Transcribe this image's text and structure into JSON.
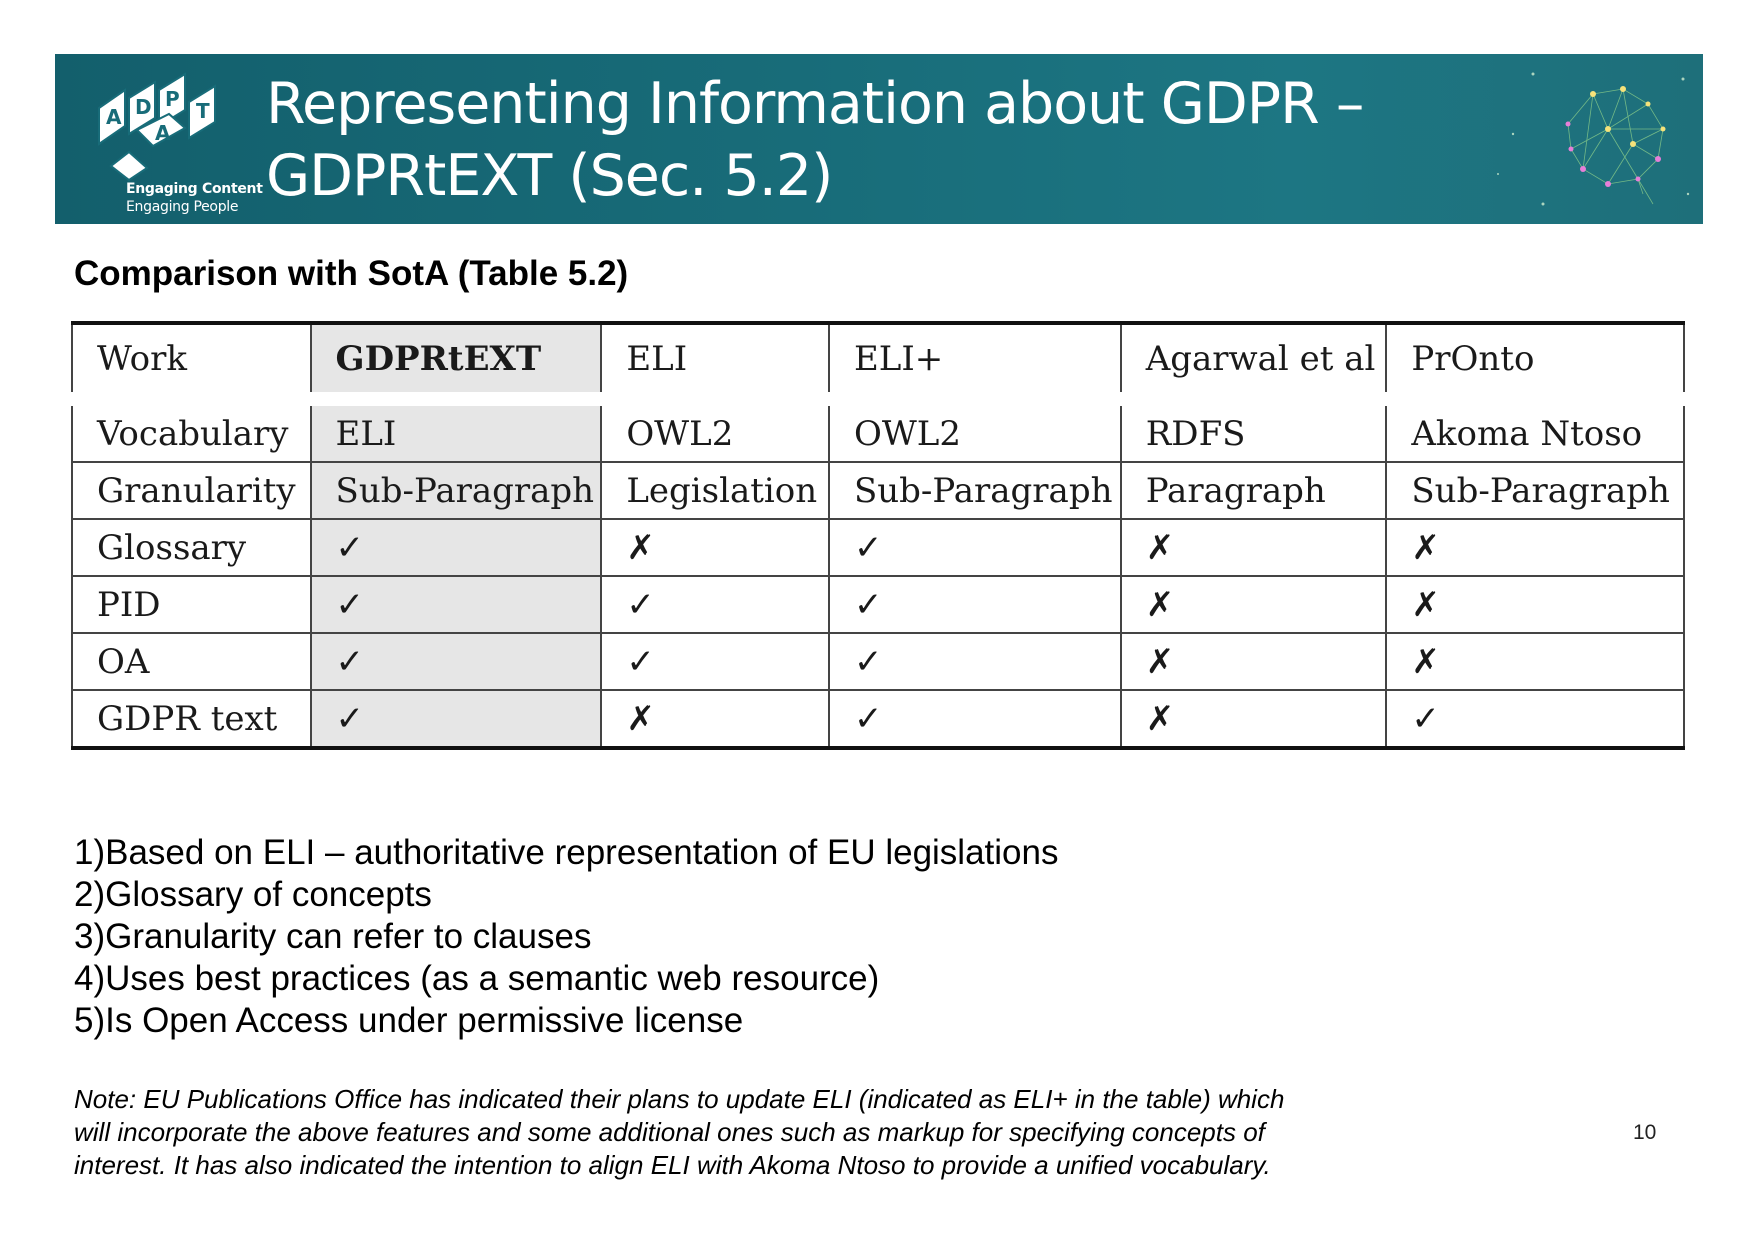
{
  "header": {
    "title_line1": "Representing Information about GDPR –",
    "title_line2": "GDPRtEXT (Sec. 5.2)",
    "logo_tagline1": "Engaging Content",
    "logo_tagline2": "Engaging People",
    "logo_letters": [
      "A",
      "D",
      "P",
      "A",
      "T"
    ],
    "colors": {
      "banner": "#186c79",
      "text": "#ffffff"
    }
  },
  "section_heading": "Comparison with SotA (Table 5.2)",
  "table": {
    "columns": [
      "Work",
      "GDPRtEXT",
      "ELI",
      "ELI+",
      "Agarwal et al",
      "PrOnto"
    ],
    "highlight_column": "GDPRtEXT",
    "rows": [
      {
        "label": "Vocabulary",
        "cells": [
          "ELI",
          "OWL2",
          "OWL2",
          "RDFS",
          "Akoma Ntoso"
        ]
      },
      {
        "label": "Granularity",
        "cells": [
          "Sub-Paragraph",
          "Legislation",
          "Sub-Paragraph",
          "Paragraph",
          "Sub-Paragraph"
        ]
      },
      {
        "label": "Glossary",
        "cells": [
          "✓",
          "✗",
          "✓",
          "✗",
          "✗"
        ]
      },
      {
        "label": "PID",
        "cells": [
          "✓",
          "✓",
          "✓",
          "✗",
          "✗"
        ]
      },
      {
        "label": "OA",
        "cells": [
          "✓",
          "✓",
          "✓",
          "✗",
          "✗"
        ]
      },
      {
        "label": "GDPR text",
        "cells": [
          "✓",
          "✗",
          "✓",
          "✗",
          "✓"
        ]
      }
    ]
  },
  "points": [
    "1)Based on ELI – authoritative representation of EU legislations",
    "2)Glossary of concepts",
    "3)Granularity can refer to clauses",
    "4)Uses best practices (as a semantic web resource)",
    "5)Is Open Access under permissive license"
  ],
  "note": "Note: EU Publications Office has indicated their plans to update ELI (indicated as ELI+ in the table) which will incorporate the above features and some additional ones such as markup for specifying concepts of interest. It has also indicated the intention to align ELI with Akoma Ntoso to provide a unified vocabulary.",
  "page_number": "10"
}
